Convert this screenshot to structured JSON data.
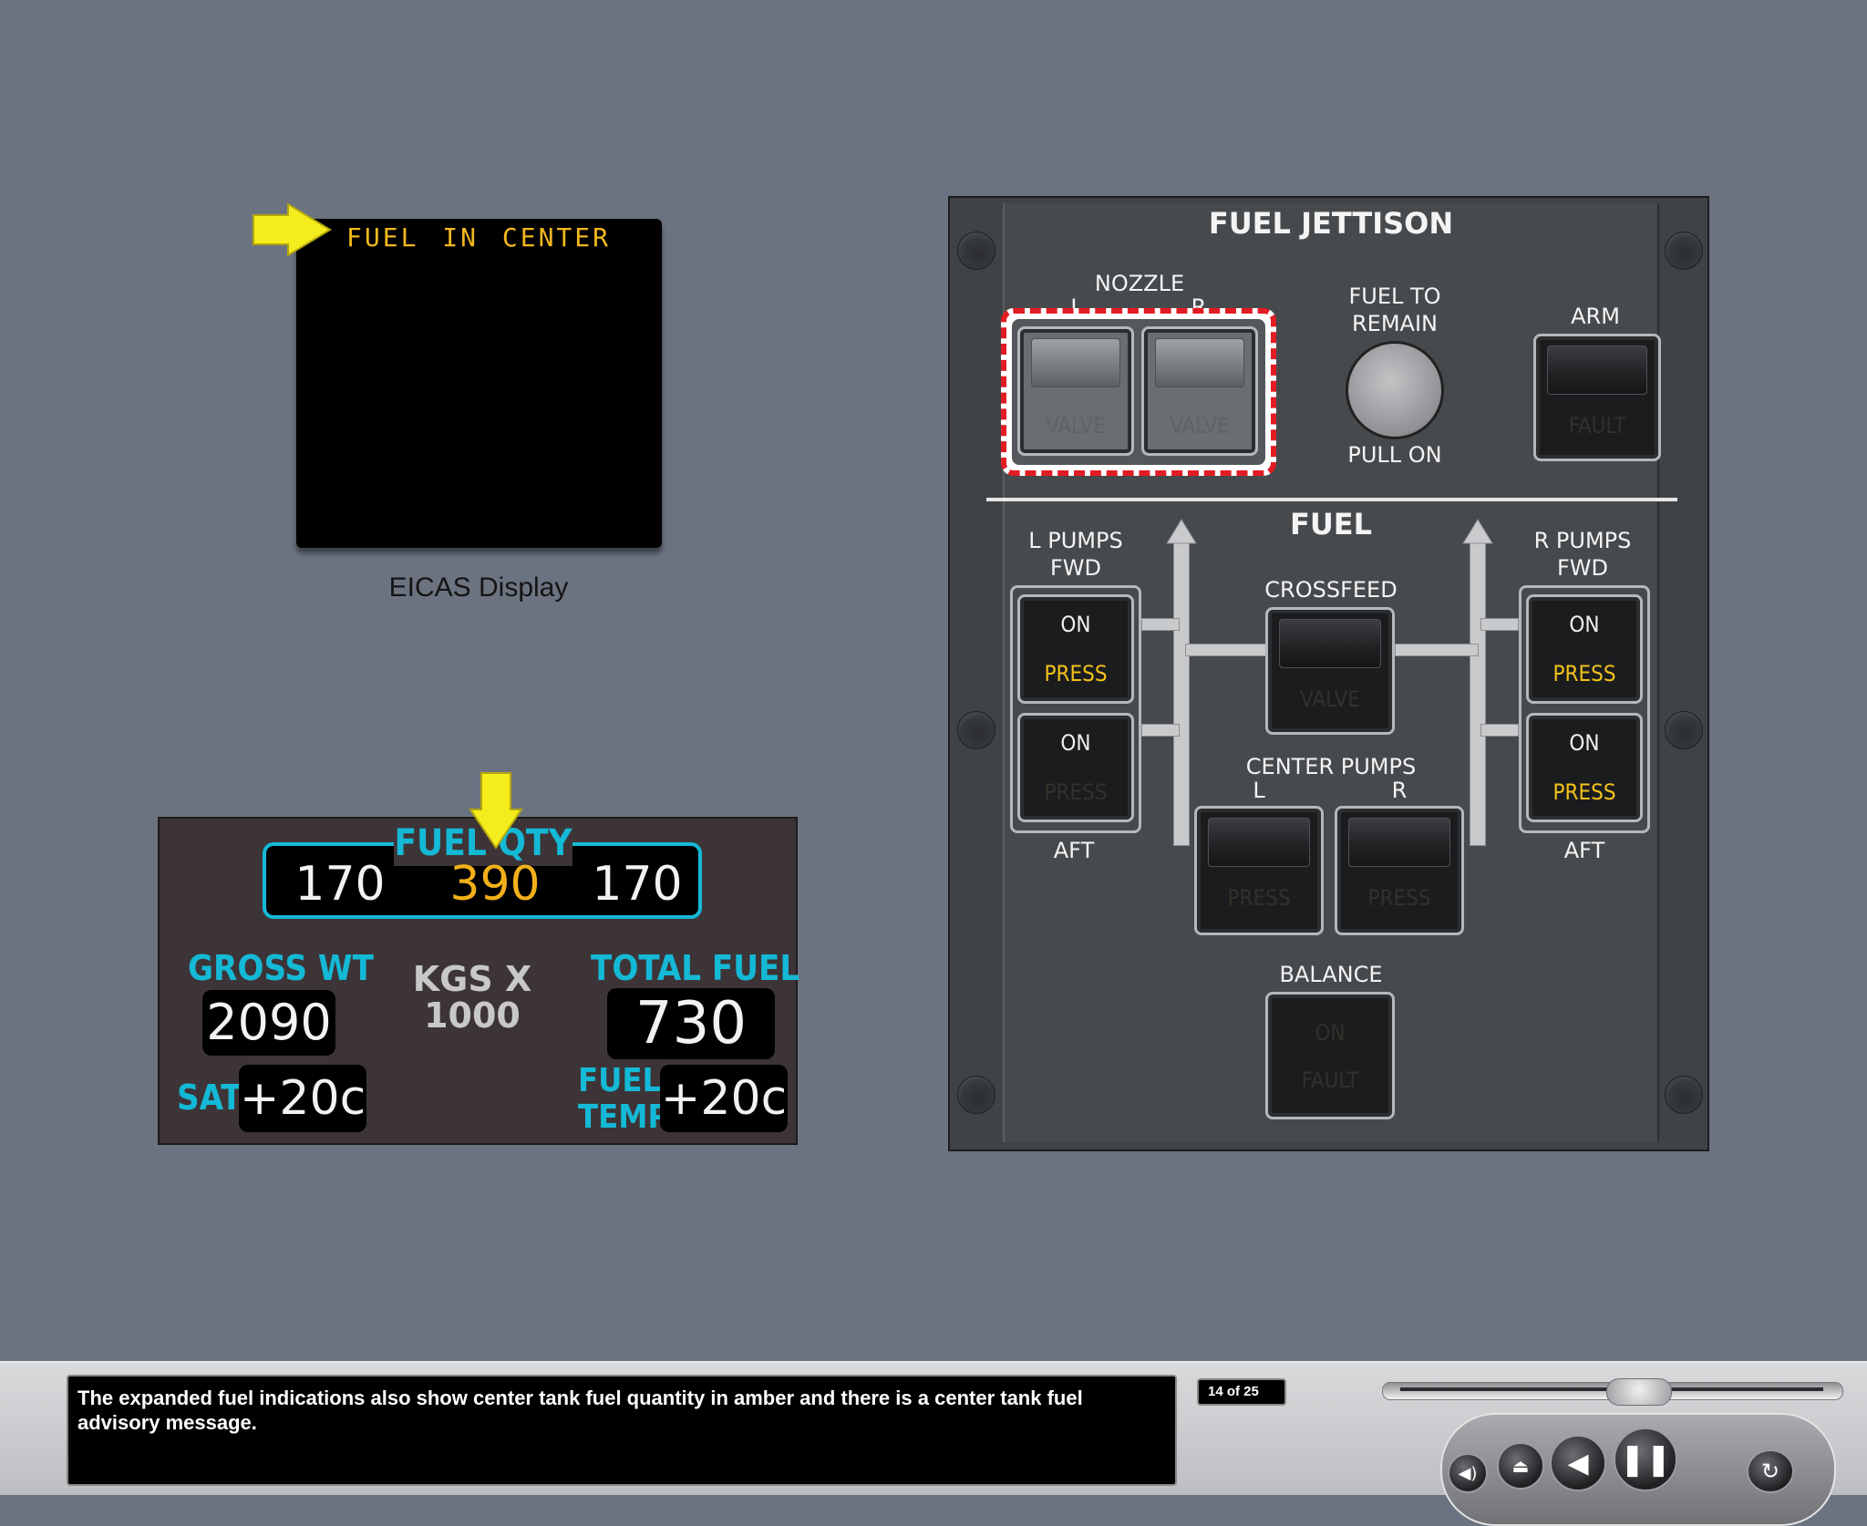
{
  "eicas": {
    "message": "FUEL IN CENTER",
    "caption": "EICAS Display"
  },
  "fuel_display": {
    "title": "FUEL QTY",
    "left_tank": "170",
    "center_tank": "390",
    "right_tank": "170",
    "gross_wt_label": "GROSS WT",
    "gross_wt_value": "2090",
    "units_line1": "KGS X",
    "units_line2": "1000",
    "total_fuel_label": "TOTAL FUEL",
    "total_fuel_value": "730",
    "sat_label": "SAT",
    "sat_value": "+20c",
    "fuel_temp_label_1": "FUEL",
    "fuel_temp_label_2": "TEMP",
    "fuel_temp_value": "+20c"
  },
  "panel": {
    "jettison_title": "FUEL JETTISON",
    "nozzle_label": "NOZZLE",
    "nozzle_l": "L",
    "nozzle_r": "R",
    "valve_legend": "VALVE",
    "fuel_to_remain_1": "FUEL TO",
    "fuel_to_remain_2": "REMAIN",
    "pull_on": "PULL ON",
    "arm_label": "ARM",
    "fault_legend": "FAULT",
    "fuel_title": "FUEL",
    "l_pumps_1": "L PUMPS",
    "l_pumps_2": "FWD",
    "r_pumps_1": "R PUMPS",
    "r_pumps_2": "FWD",
    "aft_label": "AFT",
    "on_legend": "ON",
    "press_legend": "PRESS",
    "crossfeed_label": "CROSSFEED",
    "center_pumps_label": "CENTER PUMPS",
    "center_l": "L",
    "center_r": "R",
    "balance_label": "BALANCE"
  },
  "player": {
    "caption": "The expanded fuel indications also show center tank fuel quantity in amber and there is a center tank fuel advisory message.",
    "page_count": "14 of 25"
  },
  "colors": {
    "background": "#6c7380",
    "cyan": "#14b9d6",
    "amber": "#f3b01a",
    "arrow_yellow": "#f4ec1c",
    "hazard_red": "#e31b23"
  }
}
